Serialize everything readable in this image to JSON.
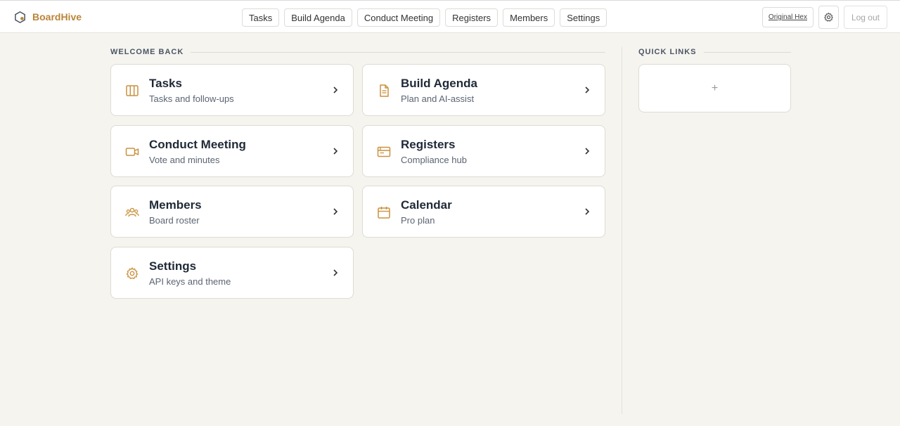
{
  "brand": {
    "name": "BoardHive"
  },
  "colors": {
    "accent": "#b9853a",
    "background": "#f5f4ef"
  },
  "nav": {
    "items": [
      {
        "label": "Tasks"
      },
      {
        "label": "Build Agenda"
      },
      {
        "label": "Conduct Meeting"
      },
      {
        "label": "Registers"
      },
      {
        "label": "Members"
      },
      {
        "label": "Settings"
      }
    ]
  },
  "header_tools": {
    "original_hex_label": "Original Hex",
    "settings_icon": "gear-icon",
    "logout_label": "Log out"
  },
  "welcome": {
    "heading": "WELCOME BACK",
    "cards": [
      {
        "title": "Tasks",
        "subtitle": "Tasks and follow-ups",
        "icon": "columns-icon"
      },
      {
        "title": "Build Agenda",
        "subtitle": "Plan and AI-assist",
        "icon": "document-icon"
      },
      {
        "title": "Conduct Meeting",
        "subtitle": "Vote and minutes",
        "icon": "video-icon"
      },
      {
        "title": "Registers",
        "subtitle": "Compliance hub",
        "icon": "folder-icon"
      },
      {
        "title": "Members",
        "subtitle": "Board roster",
        "icon": "users-icon"
      },
      {
        "title": "Calendar",
        "subtitle": "Pro plan",
        "icon": "calendar-icon"
      },
      {
        "title": "Settings",
        "subtitle": "API keys and theme",
        "icon": "gear-icon"
      }
    ]
  },
  "quick_links": {
    "heading": "QUICK LINKS",
    "add_label": "+"
  }
}
